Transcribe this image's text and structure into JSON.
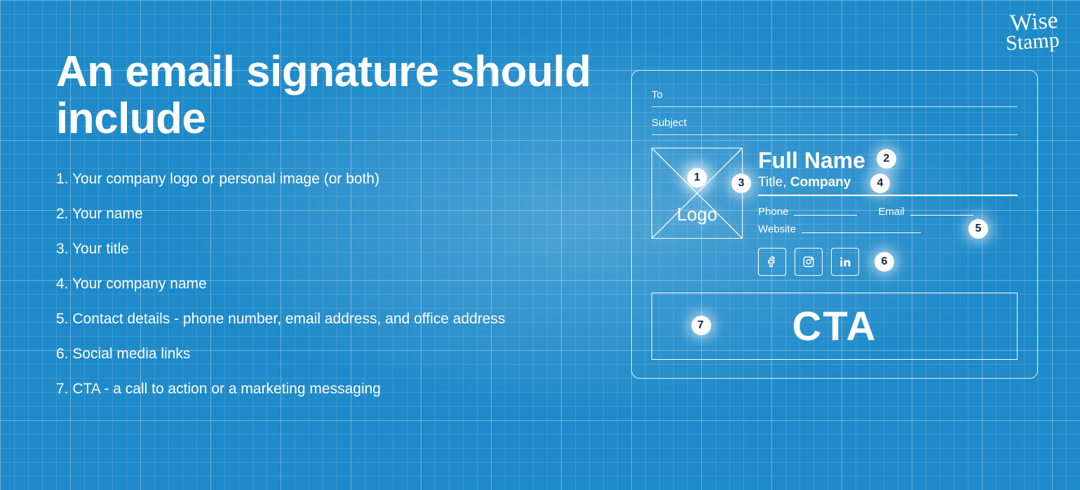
{
  "brand": {
    "line1": "Wise",
    "line2": "Stamp"
  },
  "heading": "An email signature should include",
  "items": [
    "1. Your company logo or personal image (or both)",
    "2. Your name",
    "3. Your title",
    "4. Your company name",
    "5. Contact details - phone number, email address, and office address",
    "6. Social media links",
    "7. CTA - a call to action or a marketing messaging"
  ],
  "mock": {
    "to_label": "To",
    "subject_label": "Subject",
    "logo_label": "Logo",
    "full_name": "Full Name",
    "title_label": "Title,",
    "company_label": "Company",
    "phone_label": "Phone",
    "email_label": "Email",
    "website_label": "Website",
    "cta_label": "CTA",
    "badges": {
      "b1": "1",
      "b2": "2",
      "b3": "3",
      "b4": "4",
      "b5": "5",
      "b6": "6",
      "b7": "7"
    },
    "social": {
      "fb": "facebook-icon",
      "ig": "instagram-icon",
      "li": "linkedin-icon"
    }
  }
}
